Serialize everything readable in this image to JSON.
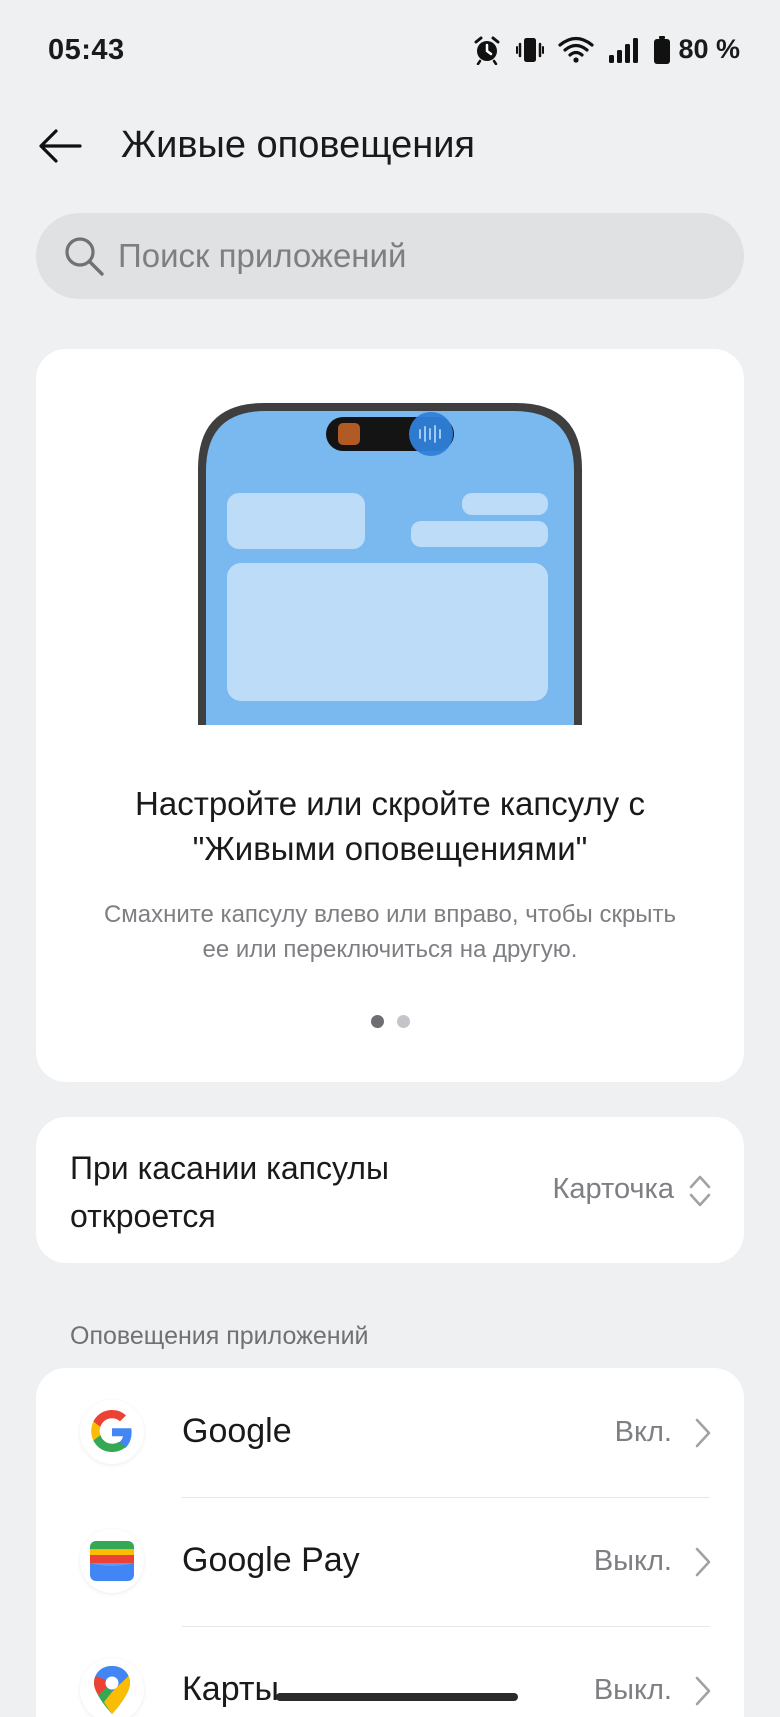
{
  "status_bar": {
    "time": "05:43",
    "battery": "80 %",
    "icons": [
      "alarm-icon",
      "vibrate-icon",
      "wifi-icon",
      "signal-icon",
      "battery-icon"
    ]
  },
  "header": {
    "title": "Живые оповещения",
    "back_icon": "arrow-left-icon"
  },
  "search": {
    "placeholder": "Поиск приложений",
    "icon": "search-icon"
  },
  "hero": {
    "title_line1": "Настройте или скройте капсулу с",
    "title_line2": "\"Живыми оповещениями\"",
    "subtitle_line1": "Смахните капсулу влево или вправо, чтобы скрыть",
    "subtitle_line2": "ее или переключиться на другую.",
    "dots_total": 2,
    "dots_active": 1
  },
  "tap_setting": {
    "label_line1": "При касании капсулы",
    "label_line2": "откроется",
    "value": "Карточка"
  },
  "section": {
    "title": "Оповещения приложений"
  },
  "apps": [
    {
      "name": "Google",
      "status": "Вкл.",
      "icon": "google-icon"
    },
    {
      "name": "Google Pay",
      "status": "Выкл.",
      "icon": "google-pay-icon"
    },
    {
      "name": "Карты",
      "status": "Выкл.",
      "icon": "maps-icon"
    }
  ],
  "colors": {
    "background": "#eff0f2",
    "card": "#ffffff",
    "phone_screen": "#7ab9f0",
    "secondary_text": "#7d7f82"
  }
}
